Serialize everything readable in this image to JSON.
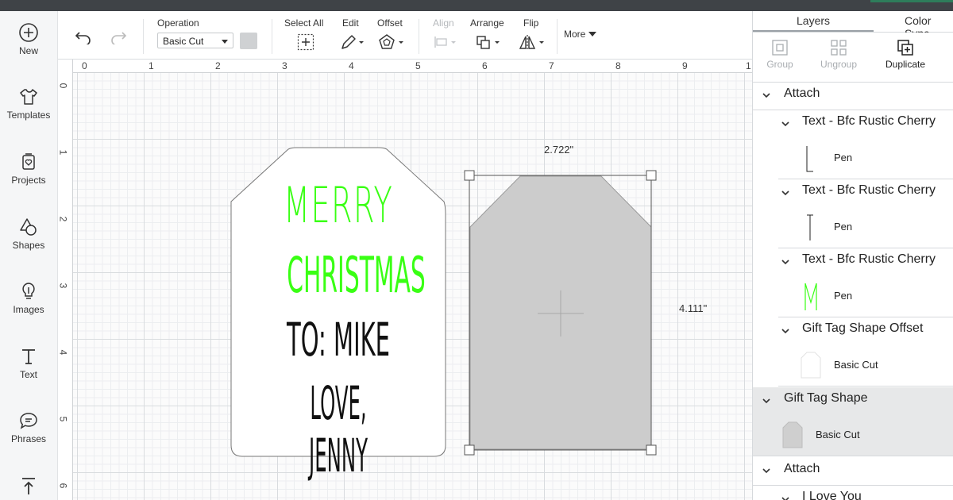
{
  "sidebar": {
    "items": [
      {
        "label": "New",
        "icon": "plus-circle-icon"
      },
      {
        "label": "Templates",
        "icon": "shirt-icon"
      },
      {
        "label": "Projects",
        "icon": "projects-icon"
      },
      {
        "label": "Shapes",
        "icon": "shapes-icon"
      },
      {
        "label": "Images",
        "icon": "lightbulb-icon"
      },
      {
        "label": "Text",
        "icon": "text-icon"
      },
      {
        "label": "Phrases",
        "icon": "speech-bubble-icon"
      },
      {
        "label": "",
        "icon": "upload-icon"
      }
    ]
  },
  "toolbar": {
    "operation_label": "Operation",
    "operation_value": "Basic Cut",
    "select_all_label": "Select All",
    "edit_label": "Edit",
    "offset_label": "Offset",
    "align_label": "Align",
    "arrange_label": "Arrange",
    "flip_label": "Flip",
    "more_label": "More"
  },
  "canvas": {
    "ruler_h": [
      "0",
      "1",
      "2",
      "3",
      "4",
      "5",
      "6",
      "7",
      "8",
      "9",
      "1"
    ],
    "ruler_v": [
      "0",
      "1",
      "2",
      "3",
      "4",
      "5",
      "6"
    ],
    "tag_text": {
      "line1": "MERRY",
      "line2": "CHRISTMAS",
      "line3": "TO: MIKE",
      "line4": "LOVE, JENNY"
    },
    "width_label": "2.722\"",
    "height_label": "4.111\"",
    "colors": {
      "green_text": "#39ff14",
      "black_text": "#111111",
      "selected_fill": "#cccccc"
    }
  },
  "panel": {
    "tabs": [
      "Layers",
      "Color Sync"
    ],
    "tools": {
      "group": "Group",
      "ungroup": "Ungroup",
      "duplicate": "Duplicate"
    },
    "layers": [
      {
        "name": "Attach",
        "sub": ""
      },
      {
        "name": "Text - Bfc Rustic Cherry",
        "sub": "Pen"
      },
      {
        "name": "Text - Bfc Rustic Cherry",
        "sub": "Pen"
      },
      {
        "name": "Text - Bfc Rustic Cherry",
        "sub": "Pen"
      },
      {
        "name": "Gift Tag Shape Offset",
        "sub": "Basic Cut"
      },
      {
        "name": "Gift Tag Shape",
        "sub": "Basic Cut"
      },
      {
        "name": "Attach",
        "sub": ""
      },
      {
        "name": "I Love You",
        "sub": ""
      }
    ]
  }
}
